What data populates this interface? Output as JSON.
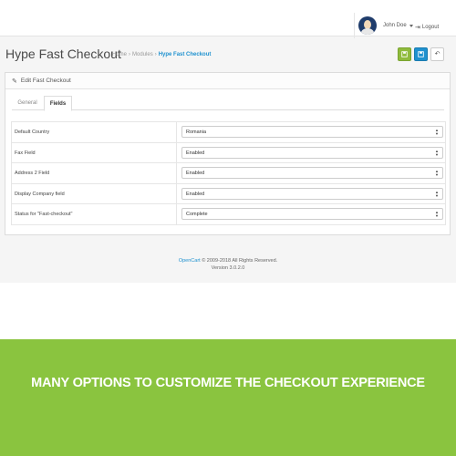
{
  "header": {
    "user_name": "John Doe",
    "logout_label": "Logout"
  },
  "page": {
    "title": "Hype Fast Checkout",
    "breadcrumb": [
      "Home",
      "Modules",
      "Hype Fast Checkout"
    ]
  },
  "actions": {
    "save_icon": "save-icon",
    "save_stay_icon": "save-stay-icon",
    "back_icon": "reply-icon"
  },
  "panel": {
    "heading": "Edit Fast Checkout",
    "tabs": [
      {
        "label": "General",
        "active": false
      },
      {
        "label": "Fields",
        "active": true
      }
    ],
    "fields": [
      {
        "label": "Default Country",
        "value": "Romania"
      },
      {
        "label": "Fax Field",
        "value": "Enabled"
      },
      {
        "label": "Address 2 Field",
        "value": "Enabled"
      },
      {
        "label": "Display Company field",
        "value": "Enabled"
      },
      {
        "label": "Status for \"Fast-checkout\"",
        "value": "Complete"
      }
    ]
  },
  "footer": {
    "link": "OpenCart",
    "copyright": "© 2009-2018 All Rights Reserved.",
    "version": "Version 3.0.2.0"
  },
  "banner": {
    "text": "MANY OPTIONS TO CUSTOMIZE THE CHECKOUT EXPERIENCE"
  },
  "colors": {
    "primary_blue": "#1e91cf",
    "success_green": "#8fbb3c",
    "banner_green": "#8ac43f"
  }
}
